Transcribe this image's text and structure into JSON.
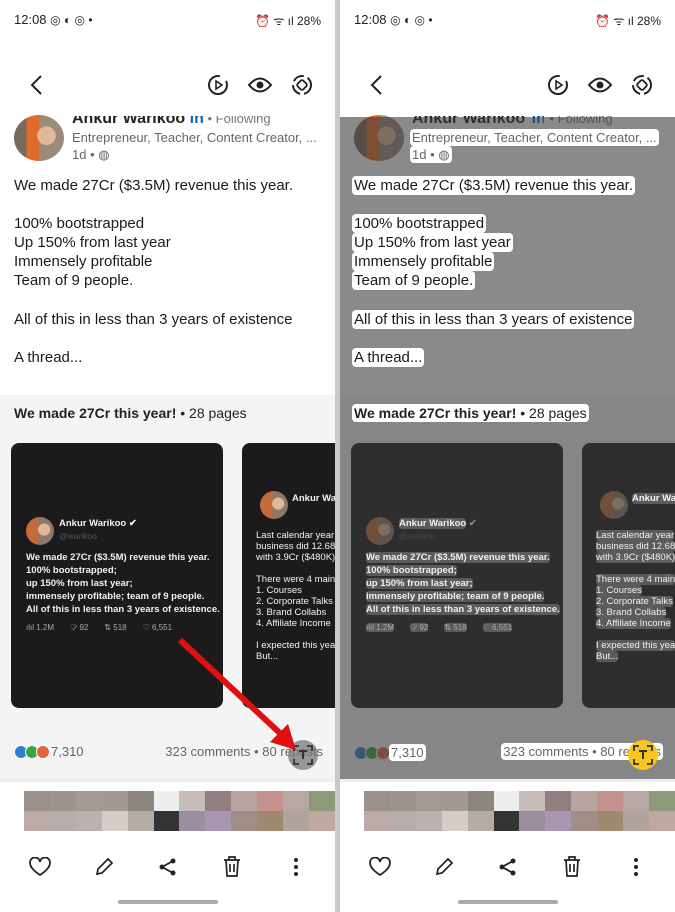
{
  "status": {
    "time": "12:08",
    "battery": "28%",
    "icons_left": [
      "instagram-icon",
      "messenger-icon",
      "instagram-icon"
    ],
    "icons_right": [
      "alarm-icon",
      "wifi-icon",
      "volte-icon",
      "signal-icon",
      "battery-icon"
    ]
  },
  "toolbar": {
    "icons": [
      "back-icon",
      "play-icon",
      "eye-icon",
      "rotate-icon"
    ]
  },
  "post": {
    "author": "Ankur Warikoo",
    "following": " • Following",
    "headline": "Entrepreneur, Teacher, Content Creator, ...",
    "age": "1d •",
    "lines": [
      "We made 27Cr ($3.5M) revenue this year.",
      "100% bootstrapped",
      "Up 150% from last year",
      "Immensely profitable",
      "Team of 9 people.",
      "All of this in less than 3 years of existence",
      "A thread..."
    ]
  },
  "document": {
    "title": "We made 27Cr this year!",
    "pages": " • 28 pages",
    "card1": {
      "name": "Ankur Warikoo",
      "handle": "@warikoo",
      "lines": [
        "We made 27Cr ($3.5M) revenue this year.",
        "100% bootstrapped;",
        "up 150% from last year;",
        "immensely profitable; team of 9 people.",
        "All of this in less than 3 years of existence."
      ],
      "stats": [
        "1.2M",
        "92",
        "518",
        "6,551"
      ]
    },
    "card2": {
      "name": "Ankur Wari",
      "lines": [
        "Last calendar year",
        "business did 12.68",
        "with 3.9Cr ($480K)",
        "",
        "There were 4 main",
        "1. Courses",
        "2. Corporate Talks",
        "3. Brand Collabs",
        "4. Affiliate Income",
        "",
        "I expected this yea",
        "But..."
      ]
    }
  },
  "social": {
    "reactions": "7,310",
    "comments": "323 comments • 80 reposts"
  },
  "bottom_bar": [
    "heart-icon",
    "edit-icon",
    "share-icon",
    "delete-icon",
    "more-icon"
  ],
  "colors": {
    "extract_active": "#f7c51c",
    "arrow": "#e01010",
    "overlay": "#8a8a8a"
  }
}
